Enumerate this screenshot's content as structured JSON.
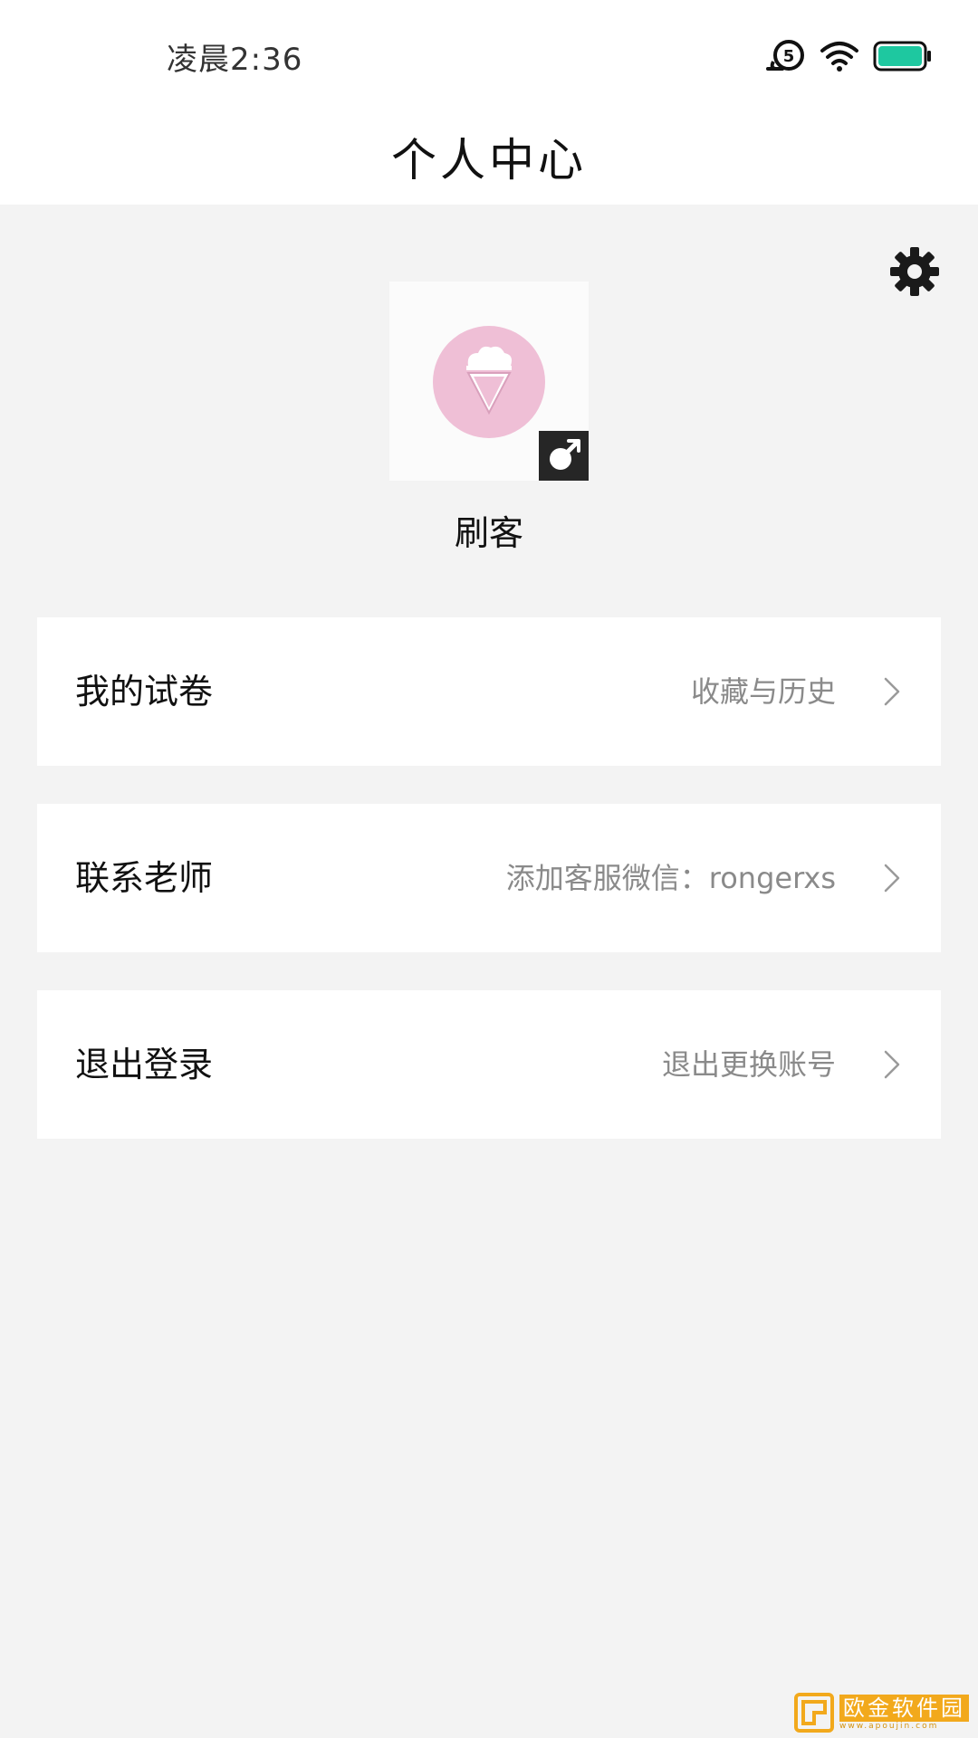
{
  "status_bar": {
    "time": "凌晨2:36",
    "battery_color": "#1ec8a0"
  },
  "header": {
    "title": "个人中心"
  },
  "profile": {
    "username": "刷客",
    "avatar_color": "#efbfd6",
    "avatar_icon": "ice-cream-icon",
    "gender_icon": "male-icon"
  },
  "menu": [
    {
      "label": "我的试卷",
      "desc": "收藏与历史"
    },
    {
      "label": "联系老师",
      "desc": "添加客服微信：rongerxs"
    },
    {
      "label": "退出登录",
      "desc": "退出更换账号"
    }
  ],
  "watermark": {
    "name": "欧金软件园",
    "url": "www.apoujin.com"
  }
}
